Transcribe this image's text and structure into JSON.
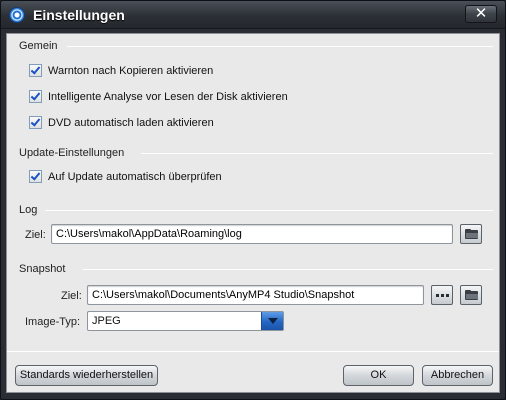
{
  "window": {
    "title": "Einstellungen",
    "close_label": "✕"
  },
  "sections": {
    "general": {
      "label": "Gemein",
      "options": [
        {
          "label": "Warnton nach Kopieren aktivieren",
          "checked": true
        },
        {
          "label": "Intelligente Analyse vor Lesen der Disk aktivieren",
          "checked": true
        },
        {
          "label": "DVD automatisch laden aktivieren",
          "checked": true
        }
      ]
    },
    "update": {
      "label": "Update-Einstellungen",
      "options": [
        {
          "label": "Auf Update automatisch überprüfen",
          "checked": true
        }
      ]
    },
    "log": {
      "label": "Log",
      "target_label": "Ziel:",
      "target_value": "C:\\Users\\makol\\AppData\\Roaming\\log"
    },
    "snapshot": {
      "label": "Snapshot",
      "target_label": "Ziel:",
      "target_value": "C:\\Users\\makol\\Documents\\AnyMP4 Studio\\Snapshot",
      "image_type_label": "Image-Typ:",
      "image_type_value": "JPEG"
    }
  },
  "buttons": {
    "restore_defaults": "Standards wiederherstellen",
    "ok": "OK",
    "cancel": "Abbrechen"
  },
  "icons": {
    "app": "app-logo-icon",
    "folder": "folder-icon",
    "more": "dots-icon",
    "dropdown": "chevron-down-icon"
  },
  "colors": {
    "accent": "#1a52c8",
    "titlebar": "#2c3036",
    "panel": "#e9e9e9",
    "dropdown": "#2467c4"
  }
}
